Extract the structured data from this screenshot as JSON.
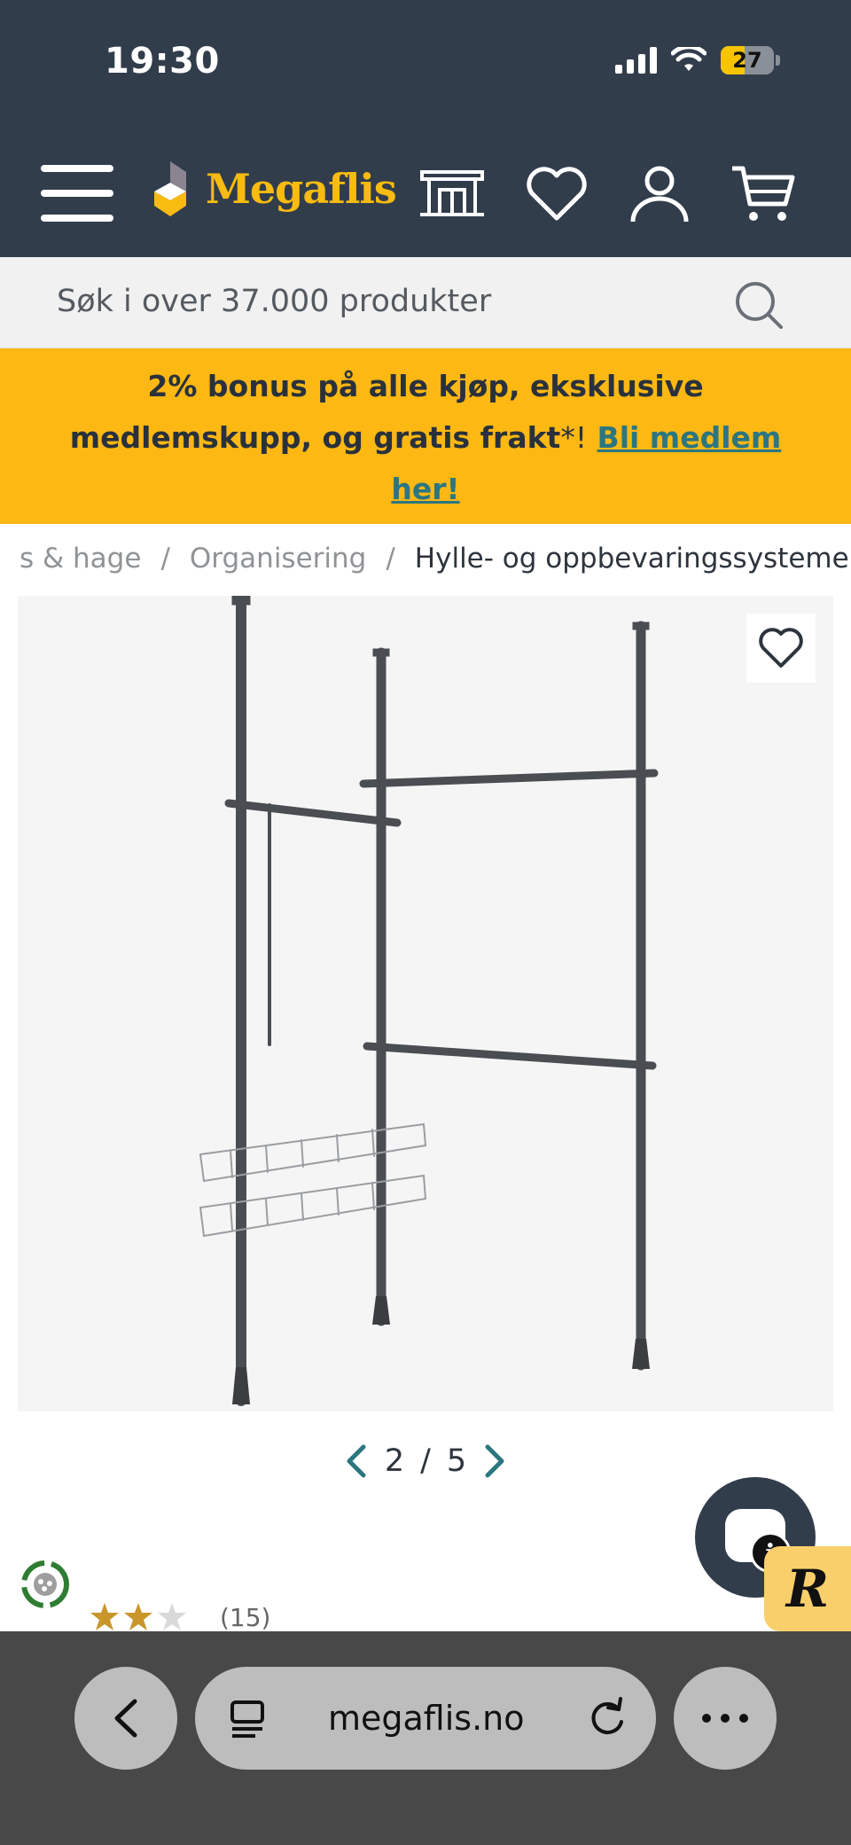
{
  "status": {
    "time": "19:30",
    "battery": "27"
  },
  "nav": {
    "logo_text": "Megaflis"
  },
  "search": {
    "placeholder": "Søk i over 37.000 produkter"
  },
  "promo": {
    "line1": "2% bonus på alle kjøp, eksklusive",
    "line2": "medlemskupp, og gratis frakt",
    "asterisk": "*!",
    "link": "Bli medlem",
    "link2": "her!"
  },
  "breadcrumb": {
    "items": [
      "s & hage",
      "Organisering",
      "Hylle- og oppbevaringssystemer"
    ],
    "separator": "/"
  },
  "pager": {
    "current": "2",
    "separator": "/",
    "total": "5"
  },
  "rating": {
    "stars_filled": 2,
    "stars_total": 3,
    "count": "(15)"
  },
  "browser": {
    "url": "megaflis.no"
  },
  "colors": {
    "header_bg": "#323d4c",
    "accent_yellow": "#fdb813",
    "logo_yellow": "#f8bb10",
    "link_teal": "#2b7680",
    "star_gold": "#c9962b"
  },
  "icons": {
    "menu": "hamburger-icon",
    "showroom": "store-icon",
    "wishlist": "heart-icon",
    "account": "user-icon",
    "cart": "cart-icon",
    "search": "search-icon",
    "chat": "chat-icon",
    "recycle": "recycle-icon"
  }
}
